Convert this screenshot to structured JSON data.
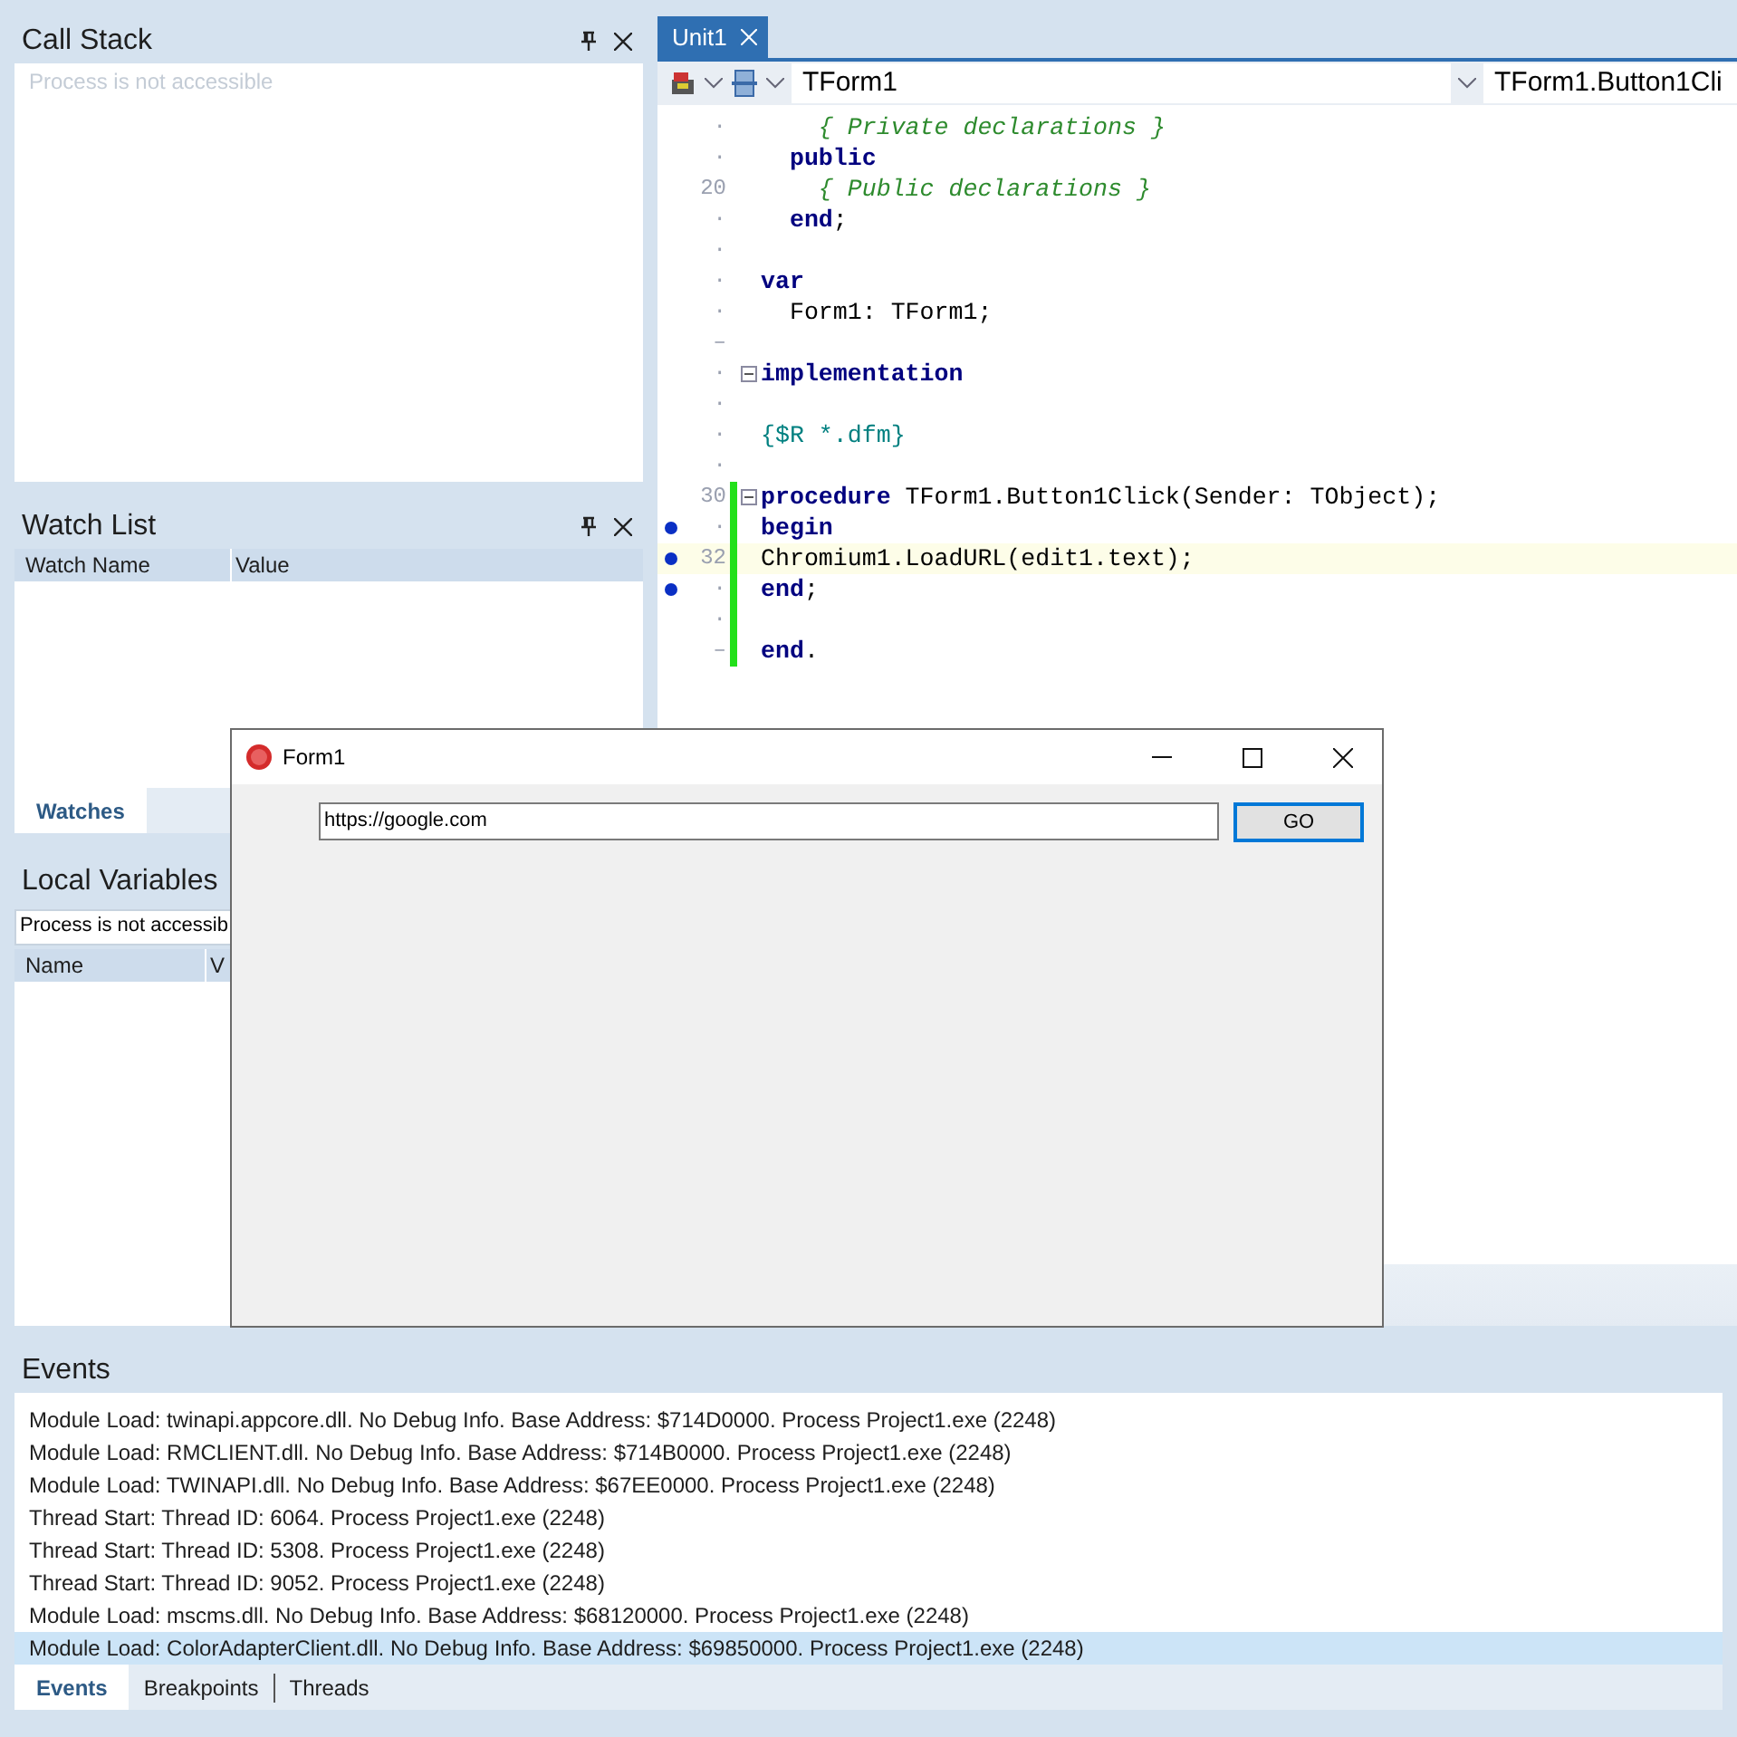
{
  "call_stack": {
    "title": "Call Stack",
    "message": "Process is not accessible"
  },
  "watch_list": {
    "title": "Watch List",
    "columns": [
      "Watch Name",
      "Value"
    ],
    "tabs": [
      {
        "label": "Watches",
        "selected": true
      }
    ]
  },
  "local_variables": {
    "title": "Local Variables",
    "message": "Process is not accessib",
    "columns": [
      "Name",
      "V"
    ]
  },
  "editor": {
    "tabs": [
      {
        "label": "Unit1",
        "selected": true
      }
    ],
    "class_combo": "TForm1",
    "method_combo": "TForm1.Button1Cli",
    "lines": [
      {
        "gutter": "·",
        "breakpoint": false,
        "modified": false,
        "fold": false,
        "highlighted": false,
        "tokens": [
          {
            "kind": "comment",
            "text": "    { Private declarations }"
          }
        ]
      },
      {
        "gutter": "·",
        "breakpoint": false,
        "modified": false,
        "fold": false,
        "highlighted": false,
        "tokens": [
          {
            "kind": "keyword",
            "text": "  public"
          }
        ]
      },
      {
        "gutter": "20",
        "breakpoint": false,
        "modified": false,
        "fold": false,
        "highlighted": false,
        "tokens": [
          {
            "kind": "comment",
            "text": "    { Public declarations }"
          }
        ]
      },
      {
        "gutter": "·",
        "breakpoint": false,
        "modified": false,
        "fold": false,
        "highlighted": false,
        "tokens": [
          {
            "kind": "keyword",
            "text": "  end"
          },
          {
            "kind": "plain",
            "text": ";"
          }
        ]
      },
      {
        "gutter": "·",
        "breakpoint": false,
        "modified": false,
        "fold": false,
        "highlighted": false
      },
      {
        "gutter": "·",
        "breakpoint": false,
        "modified": false,
        "fold": false,
        "highlighted": false,
        "tokens": [
          {
            "kind": "keyword",
            "text": "var"
          }
        ]
      },
      {
        "gutter": "·",
        "breakpoint": false,
        "modified": false,
        "fold": false,
        "highlighted": false,
        "tokens": [
          {
            "kind": "plain",
            "text": "  Form1: TForm1;"
          }
        ]
      },
      {
        "gutter": "–",
        "breakpoint": false,
        "modified": false,
        "fold": false,
        "highlighted": false
      },
      {
        "gutter": "·",
        "breakpoint": false,
        "modified": false,
        "fold": true,
        "highlighted": false,
        "tokens": [
          {
            "kind": "keyword",
            "text": "implementation"
          }
        ]
      },
      {
        "gutter": "·",
        "breakpoint": false,
        "modified": false,
        "fold": false,
        "highlighted": false
      },
      {
        "gutter": "·",
        "breakpoint": false,
        "modified": false,
        "fold": false,
        "highlighted": false,
        "tokens": [
          {
            "kind": "directive",
            "text": "{$R *.dfm}"
          }
        ]
      },
      {
        "gutter": "·",
        "breakpoint": false,
        "modified": false,
        "fold": false,
        "highlighted": false
      },
      {
        "gutter": "30",
        "breakpoint": false,
        "modified": true,
        "fold": true,
        "highlighted": false,
        "tokens": [
          {
            "kind": "keyword",
            "text": "procedure"
          },
          {
            "kind": "plain",
            "text": " TForm1.Button1Click(Sender: TObject);"
          }
        ]
      },
      {
        "gutter": "·",
        "breakpoint": true,
        "modified": true,
        "fold": false,
        "highlighted": false,
        "tokens": [
          {
            "kind": "keyword",
            "text": "begin"
          }
        ]
      },
      {
        "gutter": "32",
        "breakpoint": true,
        "modified": true,
        "fold": false,
        "highlighted": true,
        "tokens": [
          {
            "kind": "plain",
            "text": "Chromium1.LoadURL(edit1.text);"
          }
        ]
      },
      {
        "gutter": "·",
        "breakpoint": true,
        "modified": true,
        "fold": false,
        "highlighted": false,
        "tokens": [
          {
            "kind": "keyword",
            "text": "end"
          },
          {
            "kind": "plain",
            "text": ";"
          }
        ]
      },
      {
        "gutter": "·",
        "breakpoint": false,
        "modified": true,
        "fold": false,
        "highlighted": false
      },
      {
        "gutter": "–",
        "breakpoint": false,
        "modified": true,
        "fold": false,
        "highlighted": false,
        "tokens": [
          {
            "kind": "keyword",
            "text": "end"
          },
          {
            "kind": "plain",
            "text": "."
          }
        ]
      }
    ]
  },
  "events": {
    "title": "Events",
    "rows": [
      {
        "text": "Module Load: twinapi.appcore.dll. No Debug Info. Base Address: $714D0000. Process Project1.exe (2248)",
        "selected": false
      },
      {
        "text": "Module Load: RMCLIENT.dll. No Debug Info. Base Address: $714B0000. Process Project1.exe (2248)",
        "selected": false
      },
      {
        "text": "Module Load: TWINAPI.dll. No Debug Info. Base Address: $67EE0000. Process Project1.exe (2248)",
        "selected": false
      },
      {
        "text": "Thread Start: Thread ID: 6064. Process Project1.exe (2248)",
        "selected": false
      },
      {
        "text": "Thread Start: Thread ID: 5308. Process Project1.exe (2248)",
        "selected": false
      },
      {
        "text": "Thread Start: Thread ID: 9052. Process Project1.exe (2248)",
        "selected": false
      },
      {
        "text": "Module Load: mscms.dll. No Debug Info. Base Address: $68120000. Process Project1.exe (2248)",
        "selected": false
      },
      {
        "text": "Module Load: ColorAdapterClient.dll. No Debug Info. Base Address: $69850000. Process Project1.exe (2248)",
        "selected": true
      }
    ],
    "tabs": [
      {
        "label": "Events",
        "selected": true
      },
      {
        "label": "Breakpoints",
        "selected": false
      },
      {
        "label": "Threads",
        "selected": false
      }
    ]
  },
  "form_window": {
    "title": "Form1",
    "url_value": "https://google.com",
    "button": "GO"
  }
}
